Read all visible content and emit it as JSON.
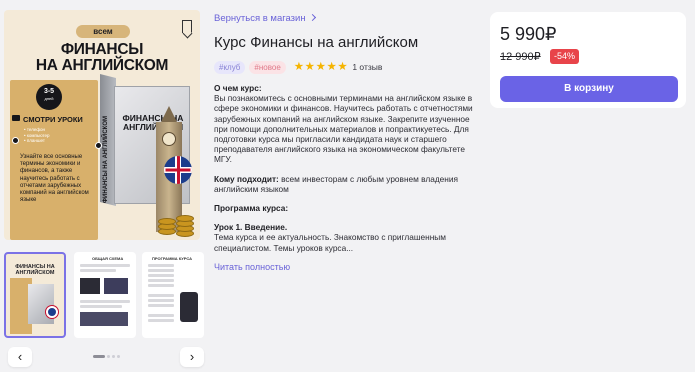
{
  "gallery": {
    "cover": {
      "badge": "всем",
      "title_line1": "ФИНАНСЫ",
      "title_line2": "НА АНГЛИЙСКОМ",
      "days_number": "3-5",
      "days_label": "дней",
      "cta": "СМОТРИ УРОКИ",
      "list": [
        "• телефон",
        "• компьютер",
        "• планшет"
      ],
      "description": "Узнайте все основные термины экономики и финансов, а также научитесь работать с отчетами зарубежных компаний на английском языке",
      "box_title": "ФИНАНСЫ НА АНГЛИЙСКОМ",
      "box_spine": "ФИНАНСЫ НА АНГЛИЙСКОМ"
    },
    "thumbs": [
      {
        "title": "ФИНАНСЫ НА АНГЛИЙСКОМ"
      },
      {
        "title": "ОБЩАЯ СХЕМА"
      },
      {
        "title": "ПРОГРАММА КУРСА"
      }
    ],
    "prev_label": "‹",
    "next_label": "›"
  },
  "details": {
    "breadcrumb": "Вернуться в магазин",
    "title": "Курс Финансы на английском",
    "tags": [
      "#клуб",
      "#новое"
    ],
    "stars": "★★★★★",
    "rating_value": 5,
    "reviews": "1 отзыв",
    "about_heading": "О чем курс:",
    "about_text": "Вы познакомитесь с основными терминами на английском языке в сфере экономики и финансов. Научитесь работать с отчетностями зарубежных компаний на английском языке. Закрепите изученное при помощи дополнительных материалов и попрактикуетесь. Для подготовки курса мы пригласили кандидата наук и старшего преподавателя английского языка на экономическом факультете МГУ.",
    "audience_heading": "Кому подходит:",
    "audience_text": " всем инвесторам с любым уровнем владения английским языком",
    "program_heading": "Программа курса:",
    "lesson_heading": "Урок 1. Введение.",
    "lesson_text": "Тема курса и ее актуальность. Знакомство с приглашенным специалистом. Темы уроков курса...",
    "read_more": "Читать полностью"
  },
  "price_card": {
    "price": "5 990₽",
    "old_price": "12 990₽",
    "discount": "-54%",
    "cart_button": "В корзину"
  },
  "colors": {
    "accent": "#6a63e6",
    "discount": "#e8444a",
    "stars": "#f5b400",
    "cover_gold": "#d8b06b"
  }
}
